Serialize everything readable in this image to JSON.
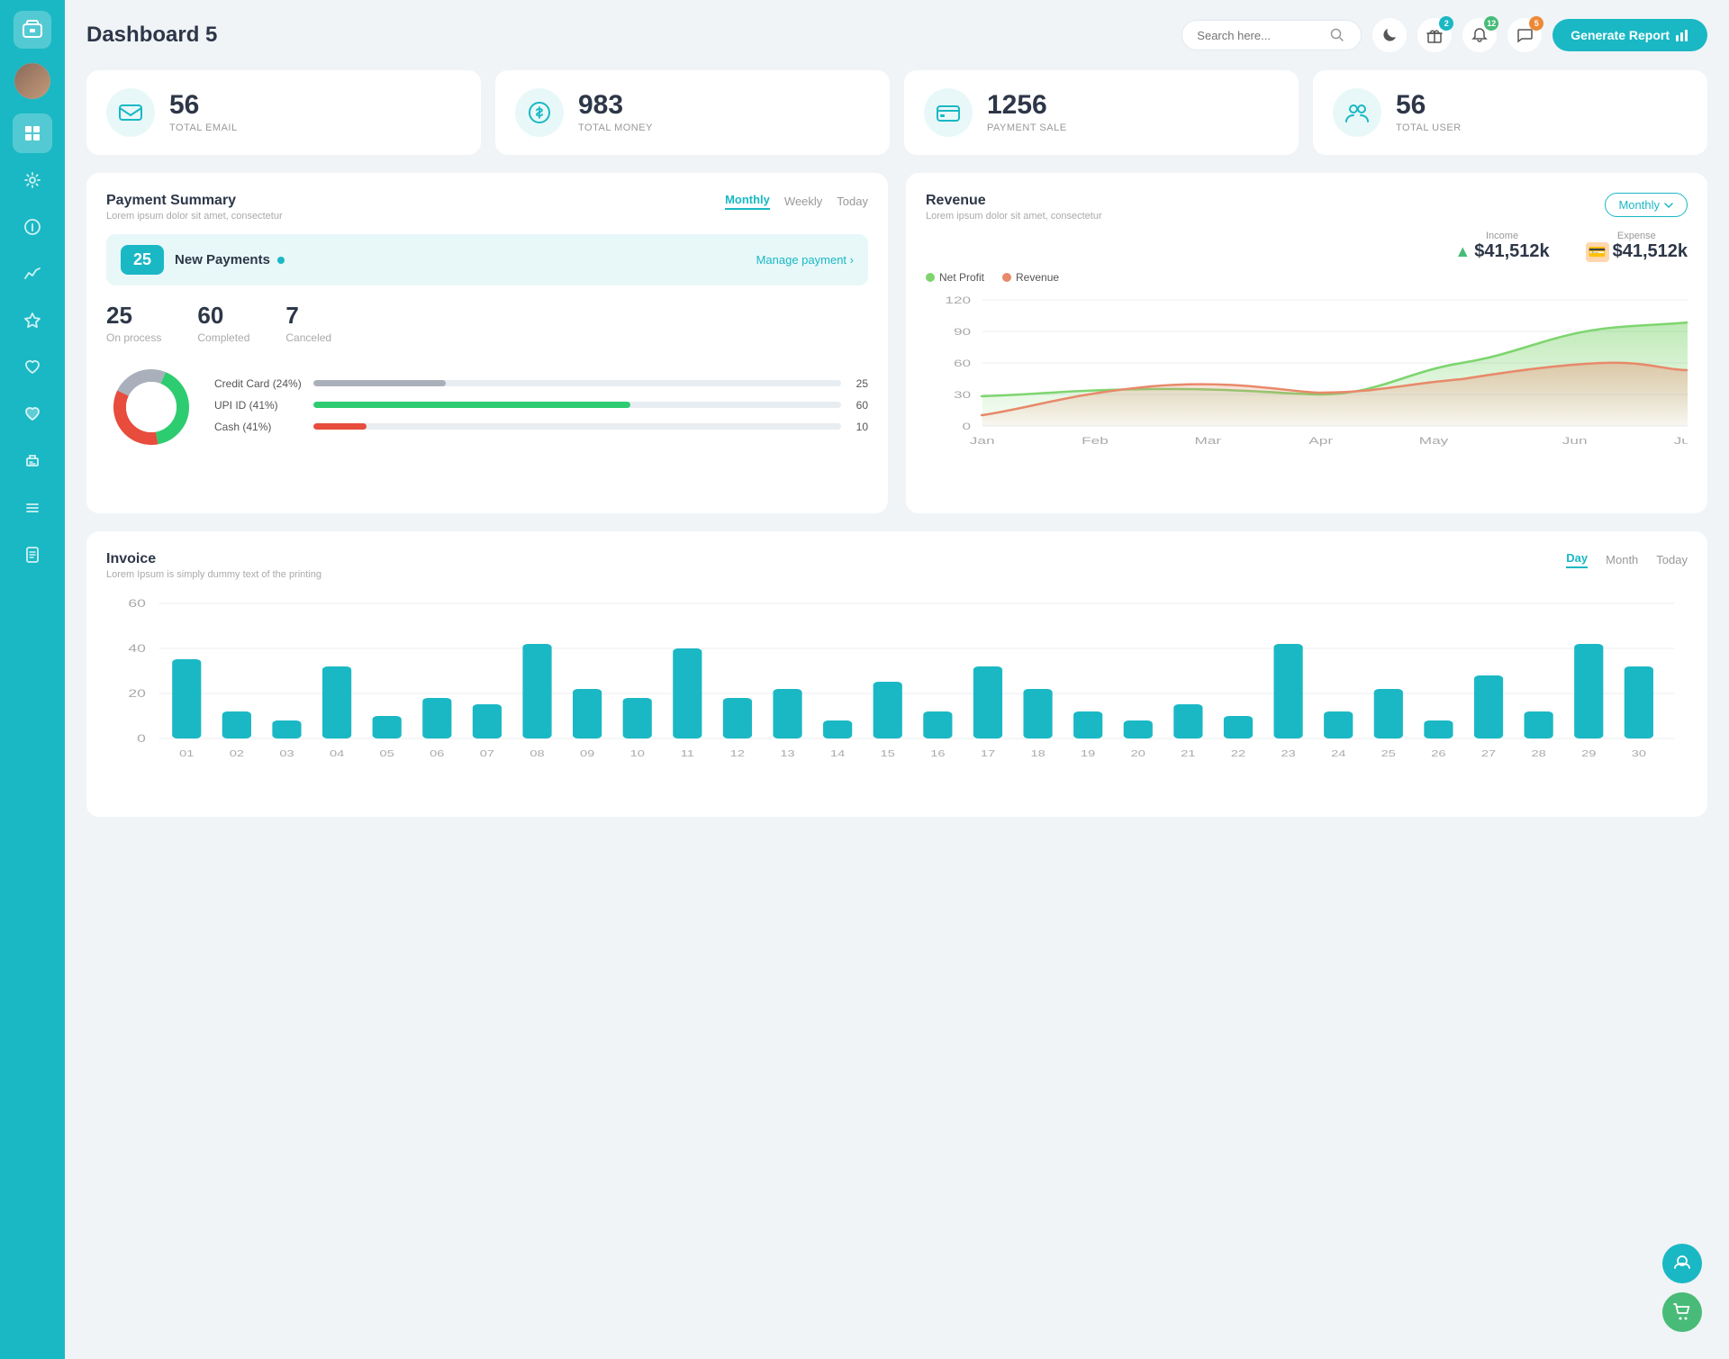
{
  "app": {
    "title": "Dashboard 5"
  },
  "header": {
    "search_placeholder": "Search here...",
    "generate_btn": "Generate Report",
    "badges": {
      "gift": "2",
      "bell": "12",
      "chat": "5"
    }
  },
  "stats": [
    {
      "id": "email",
      "value": "56",
      "label": "TOTAL EMAIL",
      "icon": "✉"
    },
    {
      "id": "money",
      "value": "983",
      "label": "TOTAL MONEY",
      "icon": "$"
    },
    {
      "id": "payment",
      "value": "1256",
      "label": "PAYMENT SALE",
      "icon": "💳"
    },
    {
      "id": "user",
      "value": "56",
      "label": "TOTAL USER",
      "icon": "👥"
    }
  ],
  "payment_summary": {
    "title": "Payment Summary",
    "subtitle": "Lorem ipsum dolor sit amet, consectetur",
    "tabs": [
      "Monthly",
      "Weekly",
      "Today"
    ],
    "active_tab": "Monthly",
    "new_payments_count": "25",
    "new_payments_label": "New Payments",
    "manage_link": "Manage payment",
    "stats": [
      {
        "value": "25",
        "label": "On process"
      },
      {
        "value": "60",
        "label": "Completed"
      },
      {
        "value": "7",
        "label": "Canceled"
      }
    ],
    "progress_items": [
      {
        "label": "Credit Card (24%)",
        "color": "#aab0bb",
        "width": 25,
        "value": "25"
      },
      {
        "label": "UPI ID (41%)",
        "color": "#2ecc71",
        "width": 60,
        "value": "60"
      },
      {
        "label": "Cash (41%)",
        "color": "#e74c3c",
        "width": 10,
        "value": "10"
      }
    ],
    "donut": {
      "segments": [
        {
          "color": "#aab0bb",
          "pct": 24
        },
        {
          "color": "#2ecc71",
          "pct": 41
        },
        {
          "color": "#e74c3c",
          "pct": 35
        }
      ]
    }
  },
  "revenue": {
    "title": "Revenue",
    "subtitle": "Lorem ipsum dolor sit amet, consectetur",
    "active_tab": "Monthly",
    "income_label": "Income",
    "income_value": "$41,512k",
    "expense_label": "Expense",
    "expense_value": "$41,512k",
    "legend": [
      {
        "label": "Net Profit",
        "color": "#7ed56f"
      },
      {
        "label": "Revenue",
        "color": "#e8896a"
      }
    ],
    "x_labels": [
      "Jan",
      "Feb",
      "Mar",
      "Apr",
      "May",
      "Jun",
      "July"
    ],
    "y_labels": [
      "0",
      "30",
      "60",
      "90",
      "120"
    ],
    "net_profit_data": [
      28,
      32,
      35,
      30,
      55,
      90,
      95
    ],
    "revenue_data": [
      10,
      28,
      38,
      32,
      42,
      55,
      50
    ]
  },
  "invoice": {
    "title": "Invoice",
    "subtitle": "Lorem Ipsum is simply dummy text of the printing",
    "tabs": [
      "Day",
      "Month",
      "Today"
    ],
    "active_tab": "Day",
    "y_labels": [
      "0",
      "20",
      "40",
      "60"
    ],
    "x_labels": [
      "01",
      "02",
      "03",
      "04",
      "05",
      "06",
      "07",
      "08",
      "09",
      "10",
      "11",
      "12",
      "13",
      "14",
      "15",
      "16",
      "17",
      "18",
      "19",
      "20",
      "21",
      "22",
      "23",
      "24",
      "25",
      "26",
      "27",
      "28",
      "29",
      "30"
    ],
    "bar_data": [
      35,
      12,
      8,
      32,
      10,
      18,
      15,
      42,
      22,
      18,
      40,
      18,
      22,
      8,
      25,
      12,
      32,
      22,
      12,
      8,
      15,
      10,
      42,
      12,
      22,
      8,
      28,
      12,
      42,
      32
    ]
  },
  "sidebar": {
    "items": [
      {
        "id": "wallet",
        "icon": "💳",
        "active": false
      },
      {
        "id": "dashboard",
        "icon": "▦",
        "active": true
      },
      {
        "id": "settings",
        "icon": "⚙",
        "active": false
      },
      {
        "id": "info",
        "icon": "ℹ",
        "active": false
      },
      {
        "id": "chart",
        "icon": "📊",
        "active": false
      },
      {
        "id": "star",
        "icon": "★",
        "active": false
      },
      {
        "id": "heart",
        "icon": "♥",
        "active": false
      },
      {
        "id": "heart2",
        "icon": "♥",
        "active": false
      },
      {
        "id": "print",
        "icon": "🖨",
        "active": false
      },
      {
        "id": "list",
        "icon": "☰",
        "active": false
      },
      {
        "id": "doc",
        "icon": "📄",
        "active": false
      }
    ]
  }
}
